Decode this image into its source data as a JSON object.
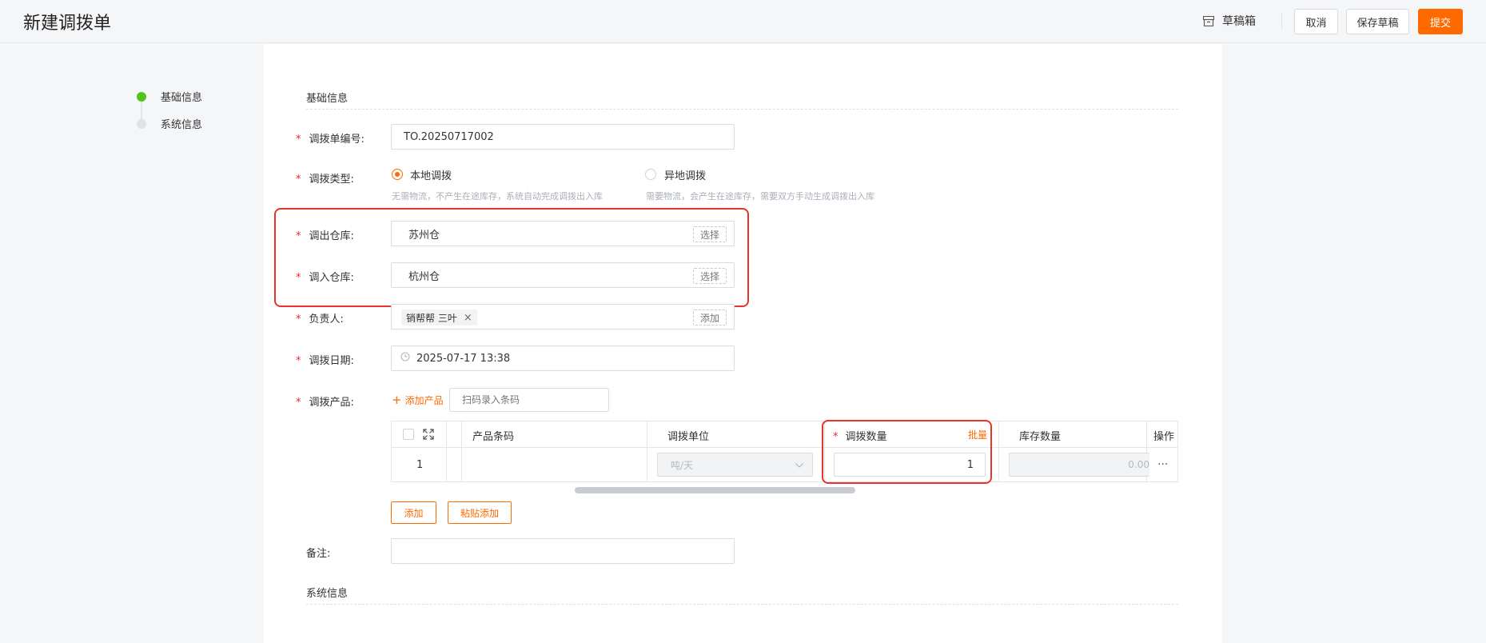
{
  "header": {
    "title": "新建调拨单",
    "draft_box": "草稿箱",
    "cancel": "取消",
    "save_draft": "保存草稿",
    "submit": "提交",
    "accent_color": "#ff6a00"
  },
  "steps": [
    {
      "label": "基础信息",
      "status": "active"
    },
    {
      "label": "系统信息",
      "status": "inactive"
    }
  ],
  "form": {
    "section_basic": "基础信息",
    "order_no": {
      "label": "调拨单编号:",
      "value": "TO.20250717002"
    },
    "transfer_type": {
      "label": "调拨类型:",
      "options": [
        {
          "label": "本地调拨",
          "hint": "无需物流，不产生在途库存，系统自动完成调拨出入库",
          "selected": true
        },
        {
          "label": "异地调拨",
          "hint": "需要物流，会产生在途库存，需要双方手动生成调拨出入库",
          "selected": false
        }
      ]
    },
    "out_warehouse": {
      "label": "调出仓库:",
      "value": "苏州仓",
      "action": "选择"
    },
    "in_warehouse": {
      "label": "调入仓库:",
      "value": "杭州仓",
      "action": "选择"
    },
    "owner": {
      "label": "负责人:",
      "tag": "销帮帮 三叶",
      "action": "添加"
    },
    "date": {
      "label": "调拨日期:",
      "value": "2025-07-17 13:38"
    },
    "products": {
      "label": "调拨产品:",
      "add_product": "添加产品",
      "scan_placeholder": "扫码录入条码",
      "columns": [
        "产品条码",
        "调拨单位",
        "调拨数量",
        "批量",
        "库存数量",
        "操作"
      ],
      "rows": [
        {
          "index": "1",
          "barcode": "",
          "unit": "吨/天",
          "quantity": "1",
          "stock": "0.00",
          "ops": "···"
        }
      ],
      "add_button": "添加",
      "paste_add_button": "粘贴添加"
    },
    "remark": {
      "label": "备注:",
      "value": ""
    },
    "section_system": "系统信息"
  }
}
